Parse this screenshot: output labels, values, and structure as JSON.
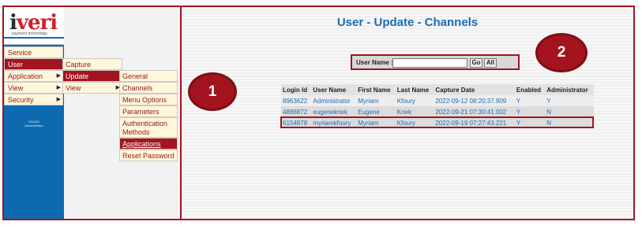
{
  "logo": {
    "text_left": "i",
    "text_right": "veri",
    "tagline": "payment technology"
  },
  "sidebar": {
    "menu": [
      {
        "label": "Service",
        "has_arrow": false,
        "selected": false
      },
      {
        "label": "User",
        "has_arrow": false,
        "selected": true
      },
      {
        "label": "Application",
        "has_arrow": true,
        "selected": false
      },
      {
        "label": "View",
        "has_arrow": true,
        "selected": false
      },
      {
        "label": "Security",
        "has_arrow": true,
        "selected": false
      }
    ],
    "user_info": [
      "631263",
      "Administrator"
    ]
  },
  "submenu": {
    "items": [
      {
        "label": "Capture",
        "has_arrow": false,
        "selected": false
      },
      {
        "label": "Update",
        "has_arrow": false,
        "selected": true
      },
      {
        "label": "View",
        "has_arrow": true,
        "selected": false
      }
    ]
  },
  "submenu2": {
    "items": [
      {
        "label": "General",
        "selected": false
      },
      {
        "label": "Channels",
        "selected": false
      },
      {
        "label": "Menu Options",
        "selected": false
      },
      {
        "label": "Parameters",
        "selected": false
      },
      {
        "label": "Authentication Methods",
        "selected": false
      },
      {
        "label": "Applications",
        "selected": true
      },
      {
        "label": "Reset Password",
        "selected": false
      }
    ]
  },
  "callouts": [
    "1",
    "2"
  ],
  "page": {
    "title": "User - Update - Channels"
  },
  "search": {
    "label": "User Name :",
    "value": "",
    "go_label": "Go",
    "all_label": "All"
  },
  "table": {
    "headers": [
      "Login Id",
      "User Name",
      "First Name",
      "Last Name",
      "Capture Date",
      "Enabled",
      "Administrator"
    ],
    "rows": [
      [
        "8963622",
        "Administrator",
        "Myriam",
        "Kfoury",
        "2022-09-12 08:20:37.909",
        "Y",
        "Y"
      ],
      [
        "4886872",
        "eugenekriek",
        "Eugene",
        "Kriek",
        "2022-09-21 07:30:41.002",
        "Y",
        "N"
      ],
      [
        "6154878",
        "myriamkfoury",
        "Myriam",
        "Kfoury",
        "2022-09-19 07:27:43.221",
        "Y",
        "N"
      ]
    ]
  },
  "colors": {
    "accent": "#a3131f",
    "link": "#1c6cb0",
    "sidebar": "#0d6ab0"
  }
}
